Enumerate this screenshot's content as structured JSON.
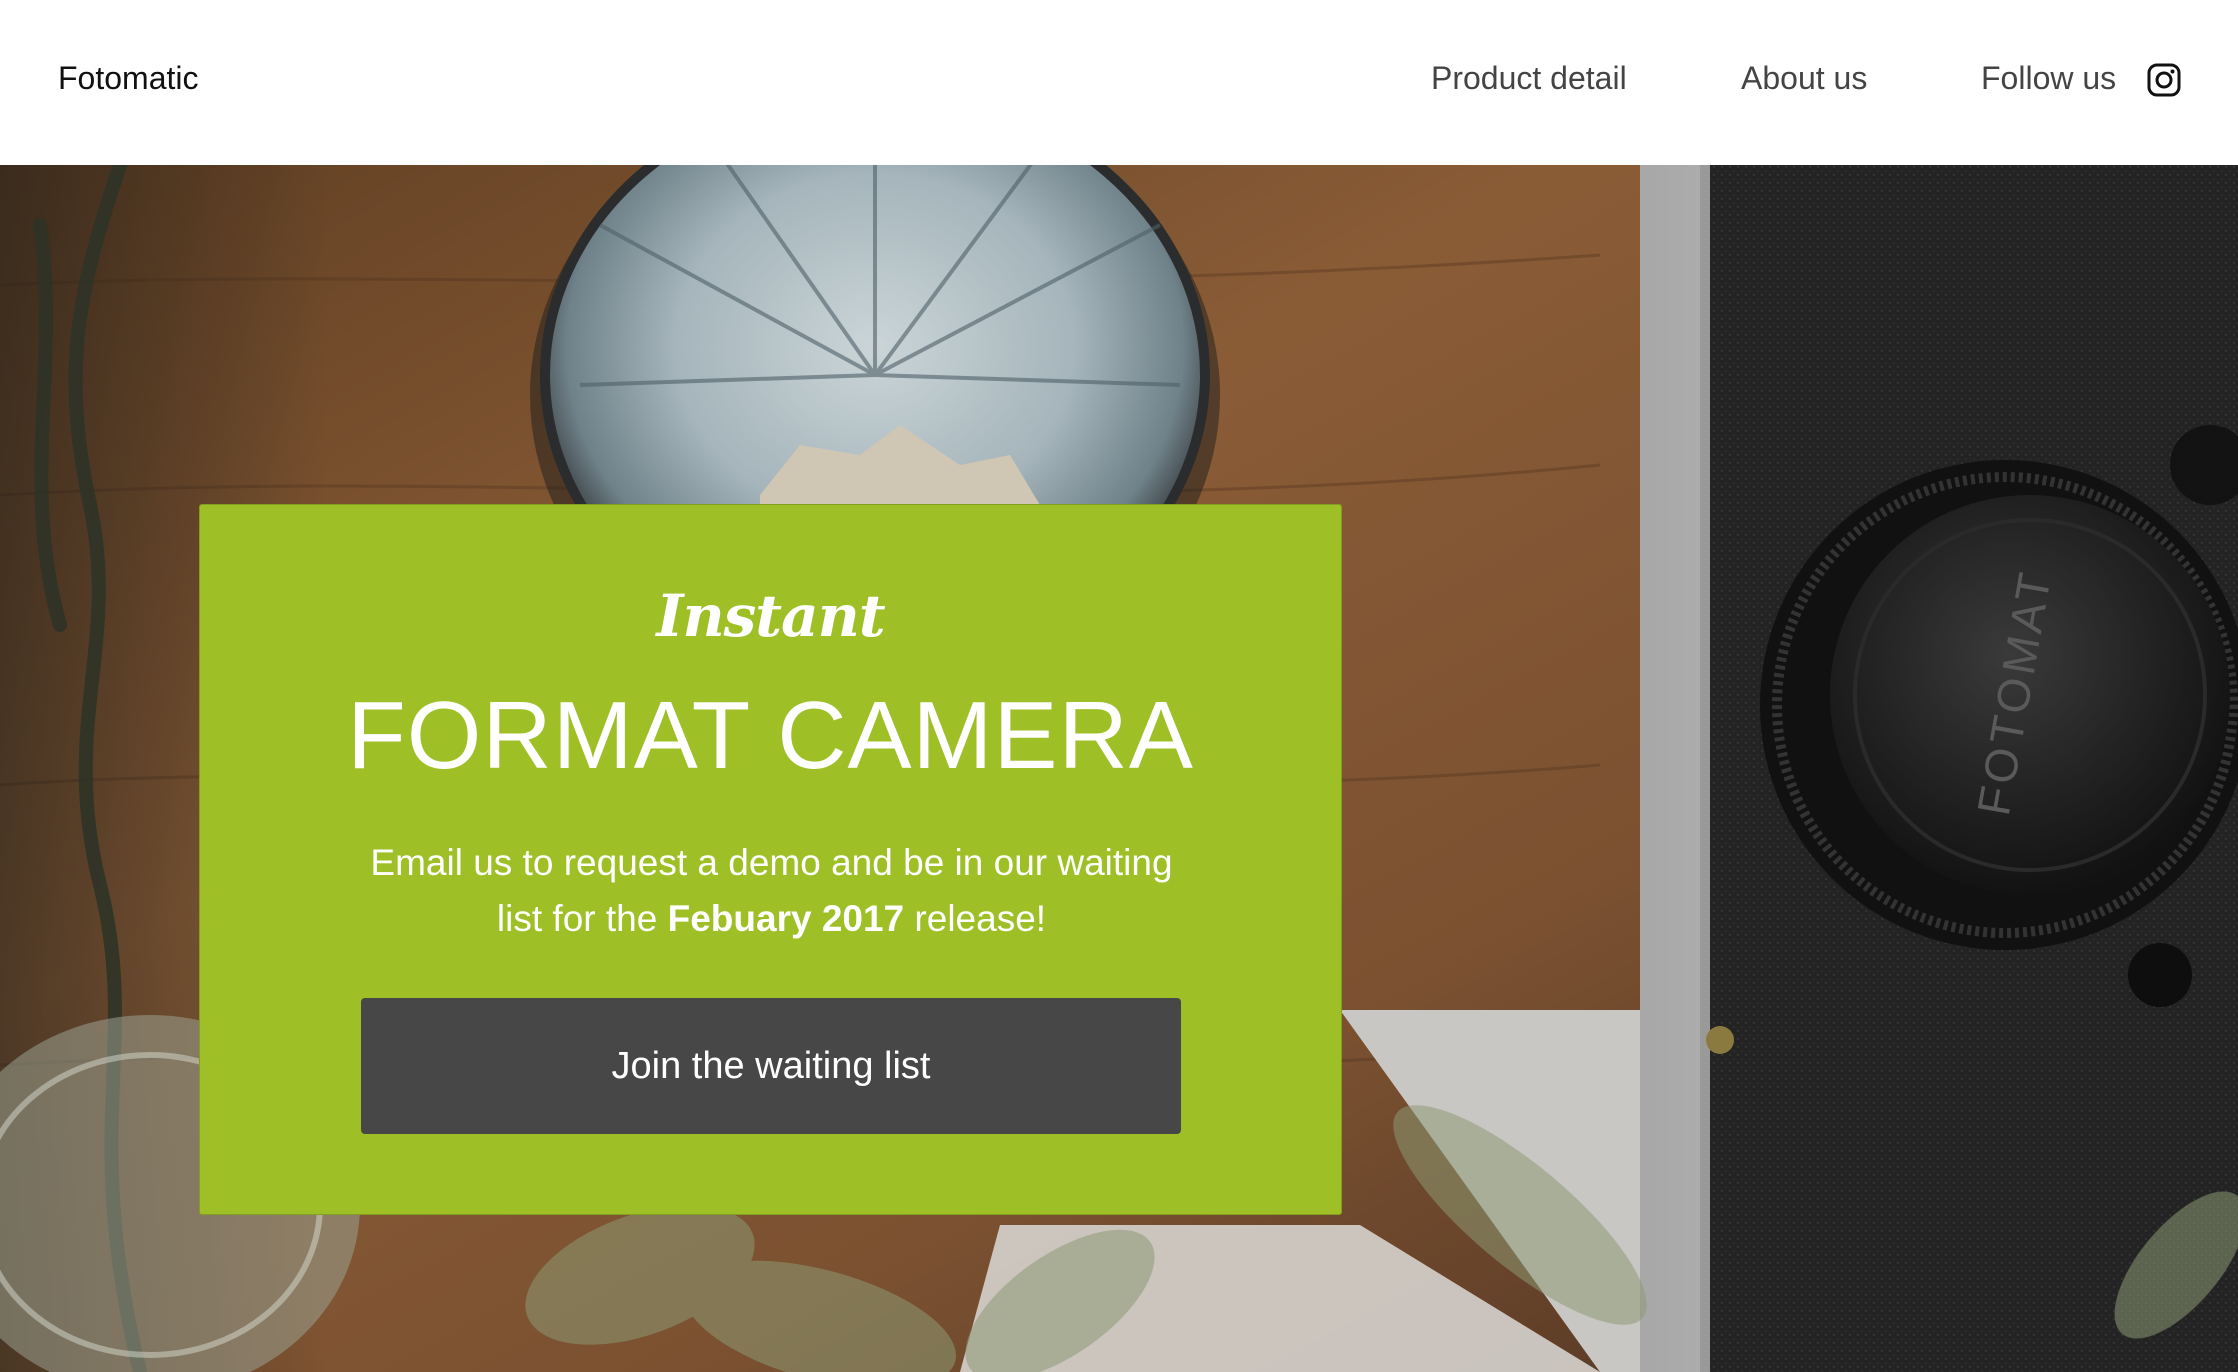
{
  "header": {
    "brand": "Fotomatic",
    "nav": {
      "product_detail": "Product detail",
      "about_us": "About us",
      "follow_us": "Follow us"
    },
    "social_icon": "instagram-icon"
  },
  "hero": {
    "background": "photo of a vintage rangefinder camera, a ceramic bowl and plants on a wooden table",
    "camera_cap_text": "FOTOMAT",
    "card": {
      "script_title": "Instant",
      "title": "FORMAT CAMERA",
      "description_part1": "Email us to request a demo and be in our waiting list for the ",
      "description_bold": "Febuary 2017",
      "description_part2": " release!",
      "button_label": "Join the waiting list"
    }
  },
  "colors": {
    "card_background": "#9ebf26",
    "button_background": "#474747",
    "header_background": "#ffffff",
    "nav_text": "#444444",
    "brand_text": "#111111"
  }
}
